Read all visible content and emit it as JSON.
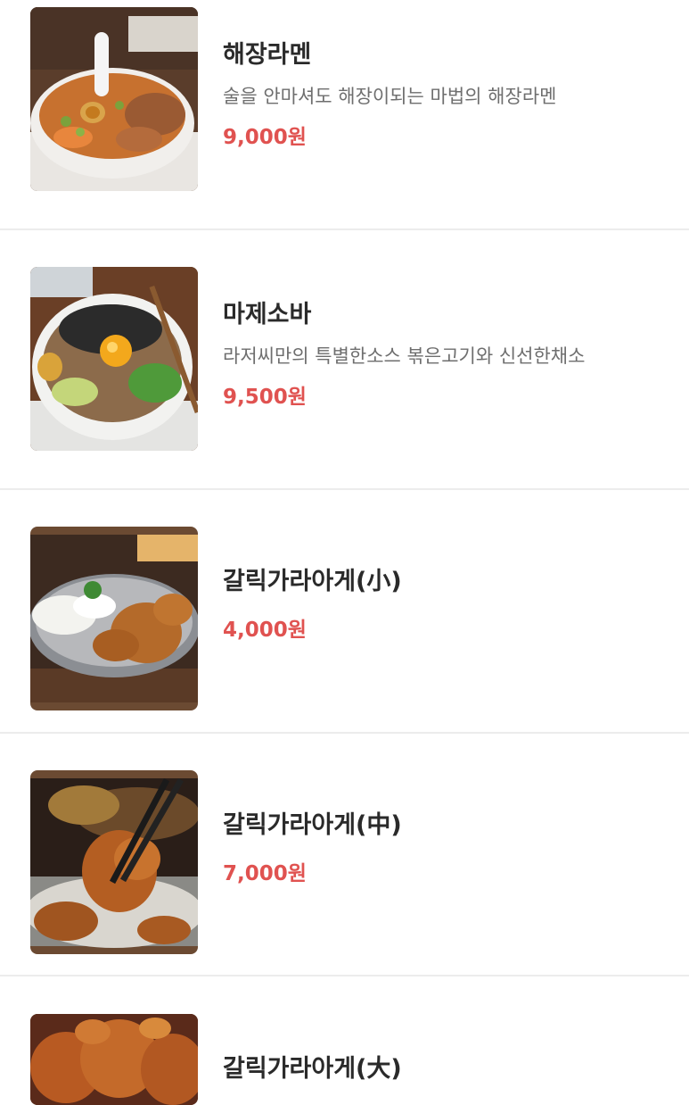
{
  "menu": {
    "items": [
      {
        "name": "해장라멘",
        "description": "술을 안마셔도 해장이되는 마법의 해장라멘",
        "price": "9,000원",
        "image_icon": "ramen-photo"
      },
      {
        "name": "마제소바",
        "description": "라저씨만의 특별한소스 볶은고기와 신선한채소",
        "price": "9,500원",
        "image_icon": "mazesoba-photo"
      },
      {
        "name": "갈릭가라아게(小)",
        "price": "4,000원",
        "image_icon": "karaage-photo"
      },
      {
        "name": "갈릭가라아게(中)",
        "price": "7,000원",
        "image_icon": "karaage-chopsticks-photo"
      },
      {
        "name": "갈릭가라아게(大)",
        "image_icon": "karaage-plate-photo"
      }
    ]
  }
}
